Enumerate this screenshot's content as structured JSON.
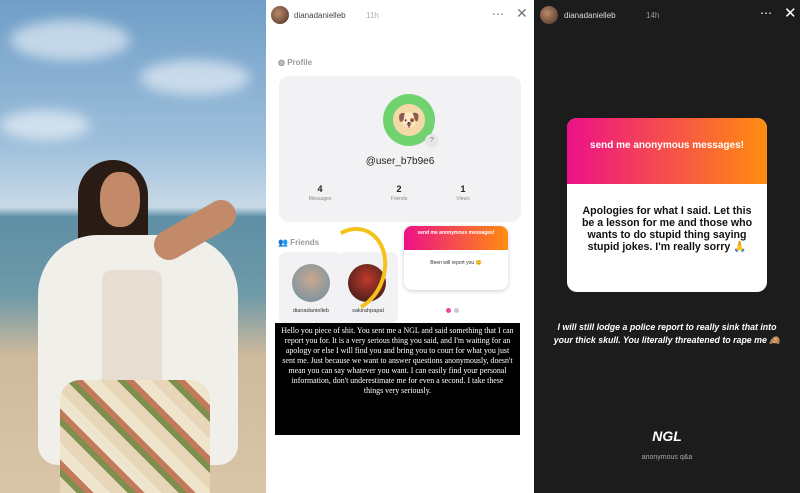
{
  "panel_middle": {
    "header": {
      "username": "dianadanielleb",
      "time": "11h"
    },
    "profile_label": "Profile",
    "profile": {
      "handle": "@user_b7b9e6",
      "stats": [
        {
          "value": "4",
          "label": "Messages"
        },
        {
          "value": "2",
          "label": "Friends"
        },
        {
          "value": "1",
          "label": "Views"
        }
      ]
    },
    "friends_label": "Friends",
    "friends": [
      {
        "name": "dianadanielleb"
      },
      {
        "name": "sakirahpapal"
      }
    ],
    "ngl_preview": {
      "title": "send me anonymous messages!",
      "reply": "Been will report you 😊"
    },
    "message": "Hello you piece of shit. You sent me a NGL and said something that I can report you for. It is a very serious thing you said, and I'm waiting for an apology or else I will find you and bring you to court for what you just sent me. Just because we want to answer questions anonymously, doesn't mean you can say whatever you want. I can easily find your personal information, don't underestimate me for even a second. I take these things very seriously."
  },
  "panel_right": {
    "header": {
      "username": "dianadanielleb",
      "time": "14h"
    },
    "ngl_card": {
      "title": "send me anonymous messages!",
      "reply": "Apologies for what I said. Let this be a lesson for me and those who wants to do stupid thing saying stupid jokes. I'm really sorry 🙏"
    },
    "caption": "I will still lodge a police report to really sink that into your thick skull. You literally threatened to rape me 🙈",
    "brand": "NGL",
    "brand_sub": "anonymous q&a"
  },
  "icons": {
    "more": "more-icon",
    "close": "close-icon"
  }
}
